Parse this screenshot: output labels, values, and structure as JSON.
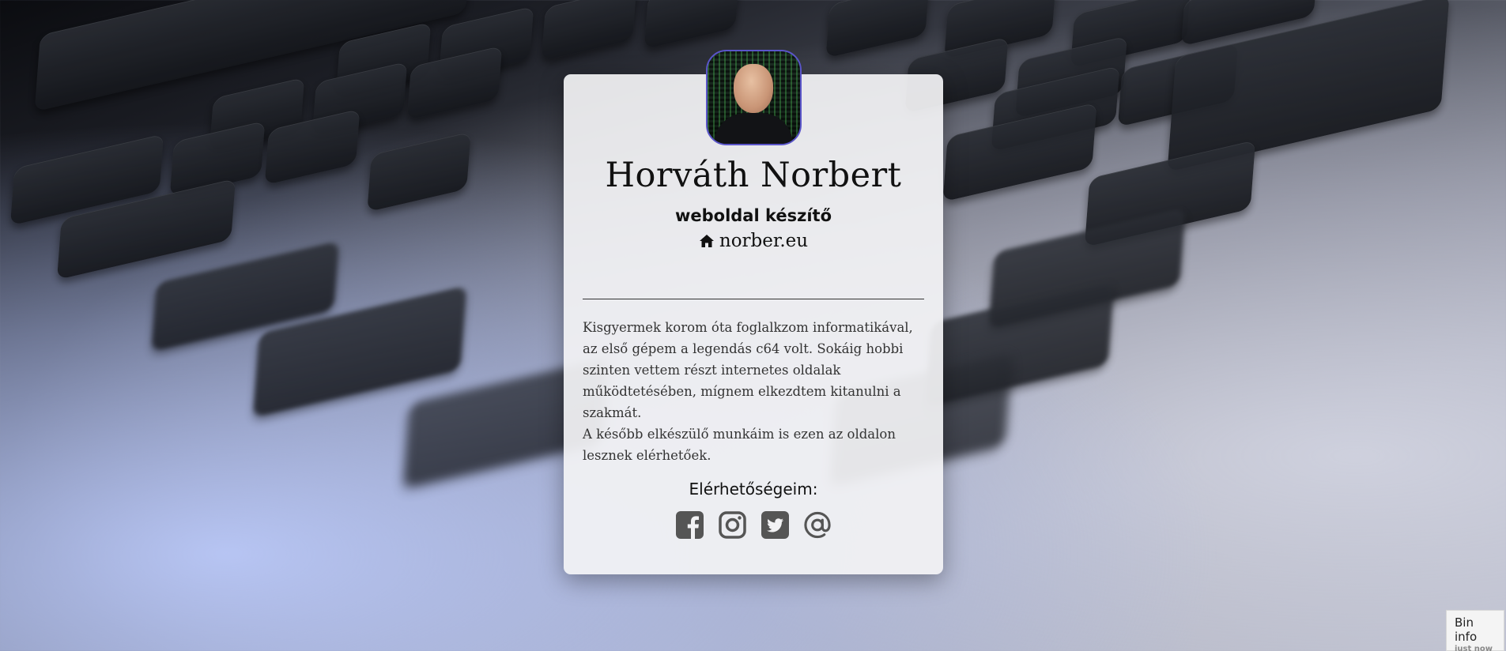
{
  "profile": {
    "name": "Horváth Norbert",
    "role": "weboldal készítő",
    "website": "norber.eu",
    "icon": "home-icon"
  },
  "about": {
    "paragraph_1": "Kisgyermek korom óta foglalkzom informatikával, az első gépem a legendás c64 volt. Sokáig hobbi szinten vettem részt internetes oldalak működtetésében, mígnem elkezdtem kitanulni a szakmát.",
    "paragraph_2": "A később elkészülő munkáim is ezen az oldalon lesznek elérhetőek."
  },
  "contact": {
    "title": "Elérhetőségeim:",
    "links": [
      {
        "icon": "facebook-icon"
      },
      {
        "icon": "instagram-icon"
      },
      {
        "icon": "twitter-icon"
      },
      {
        "icon": "email-at-icon"
      }
    ]
  },
  "bin_info": {
    "label": "Bin info",
    "time": "just now"
  },
  "colors": {
    "card_bg": "#f2f2f4",
    "icon": "#555555",
    "avatar_border": "#5a55c9"
  }
}
